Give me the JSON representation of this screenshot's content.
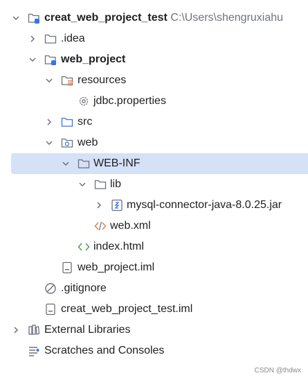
{
  "tree": {
    "root": {
      "label": "creat_web_project_test",
      "path": "C:\\Users\\shengruxiahu"
    },
    "idea": {
      "label": ".idea"
    },
    "web_project": {
      "label": "web_project"
    },
    "resources": {
      "label": "resources"
    },
    "jdbc": {
      "label": "jdbc.properties"
    },
    "src": {
      "label": "src"
    },
    "web": {
      "label": "web"
    },
    "webinf": {
      "label": "WEB-INF"
    },
    "lib": {
      "label": "lib"
    },
    "jar": {
      "label": "mysql-connector-java-8.0.25.jar"
    },
    "webxml": {
      "label": "web.xml"
    },
    "index": {
      "label": "index.html"
    },
    "iml": {
      "label": "web_project.iml"
    },
    "gitignore": {
      "label": ".gitignore"
    },
    "rootiml": {
      "label": "creat_web_project_test.iml"
    },
    "extlibs": {
      "label": "External Libraries"
    },
    "scratches": {
      "label": "Scratches and Consoles"
    }
  },
  "watermark": "CSDN @thdwx",
  "colors": {
    "selection": "#d5e1f7",
    "module_badge": "#3574f0",
    "xml": "#e8804a",
    "html": "#4aa05a"
  }
}
